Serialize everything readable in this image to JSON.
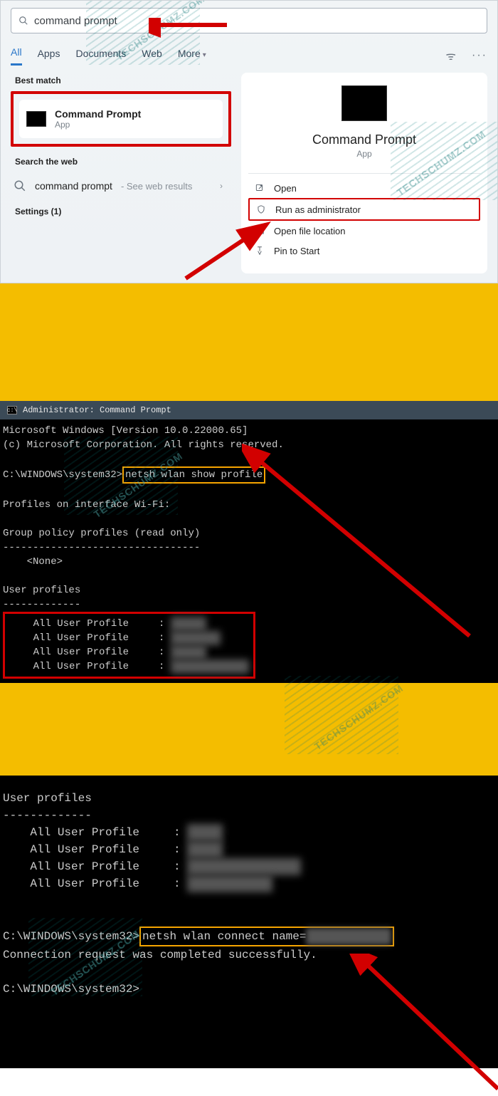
{
  "watermark_text": "TECHSCHUMZ.COM",
  "search": {
    "value": "command prompt",
    "tabs": [
      "All",
      "Apps",
      "Documents",
      "Web",
      "More"
    ],
    "best_match_label": "Best match",
    "result": {
      "title": "Command Prompt",
      "subtitle": "App"
    },
    "search_web_label": "Search the web",
    "web_query": "command prompt",
    "web_suffix": " - See web results",
    "settings_label": "Settings (1)",
    "side": {
      "title": "Command Prompt",
      "subtitle": "App",
      "actions": [
        "Open",
        "Run as administrator",
        "Open file location",
        "Pin to Start"
      ]
    }
  },
  "cmd1": {
    "title": "Administrator: Command Prompt",
    "line1": "Microsoft Windows [Version 10.0.22000.65]",
    "line2": "(c) Microsoft Corporation. All rights reserved.",
    "prompt": "C:\\WINDOWS\\system32>",
    "command": "netsh wlan show profile",
    "profiles_on": "Profiles on interface Wi-Fi:",
    "group_policy": "Group policy profiles (read only)",
    "dashes": "---------------------------------",
    "none": "    <None>",
    "user_profiles_label": "User profiles",
    "dashes2": "-------------",
    "profile_rows": [
      "    All User Profile     : ",
      "    All User Profile     : ",
      "    All User Profile     : ",
      "    All User Profile     : "
    ]
  },
  "cmd2": {
    "user_profiles_label": "User profiles",
    "dashes": "-------------",
    "profile_rows": [
      "    All User Profile     : ",
      "    All User Profile     : ",
      "    All User Profile     : ",
      "    All User Profile     : "
    ],
    "prompt": "C:\\WINDOWS\\system32>",
    "command": "netsh wlan connect name=",
    "success": "Connection request was completed successfully."
  }
}
